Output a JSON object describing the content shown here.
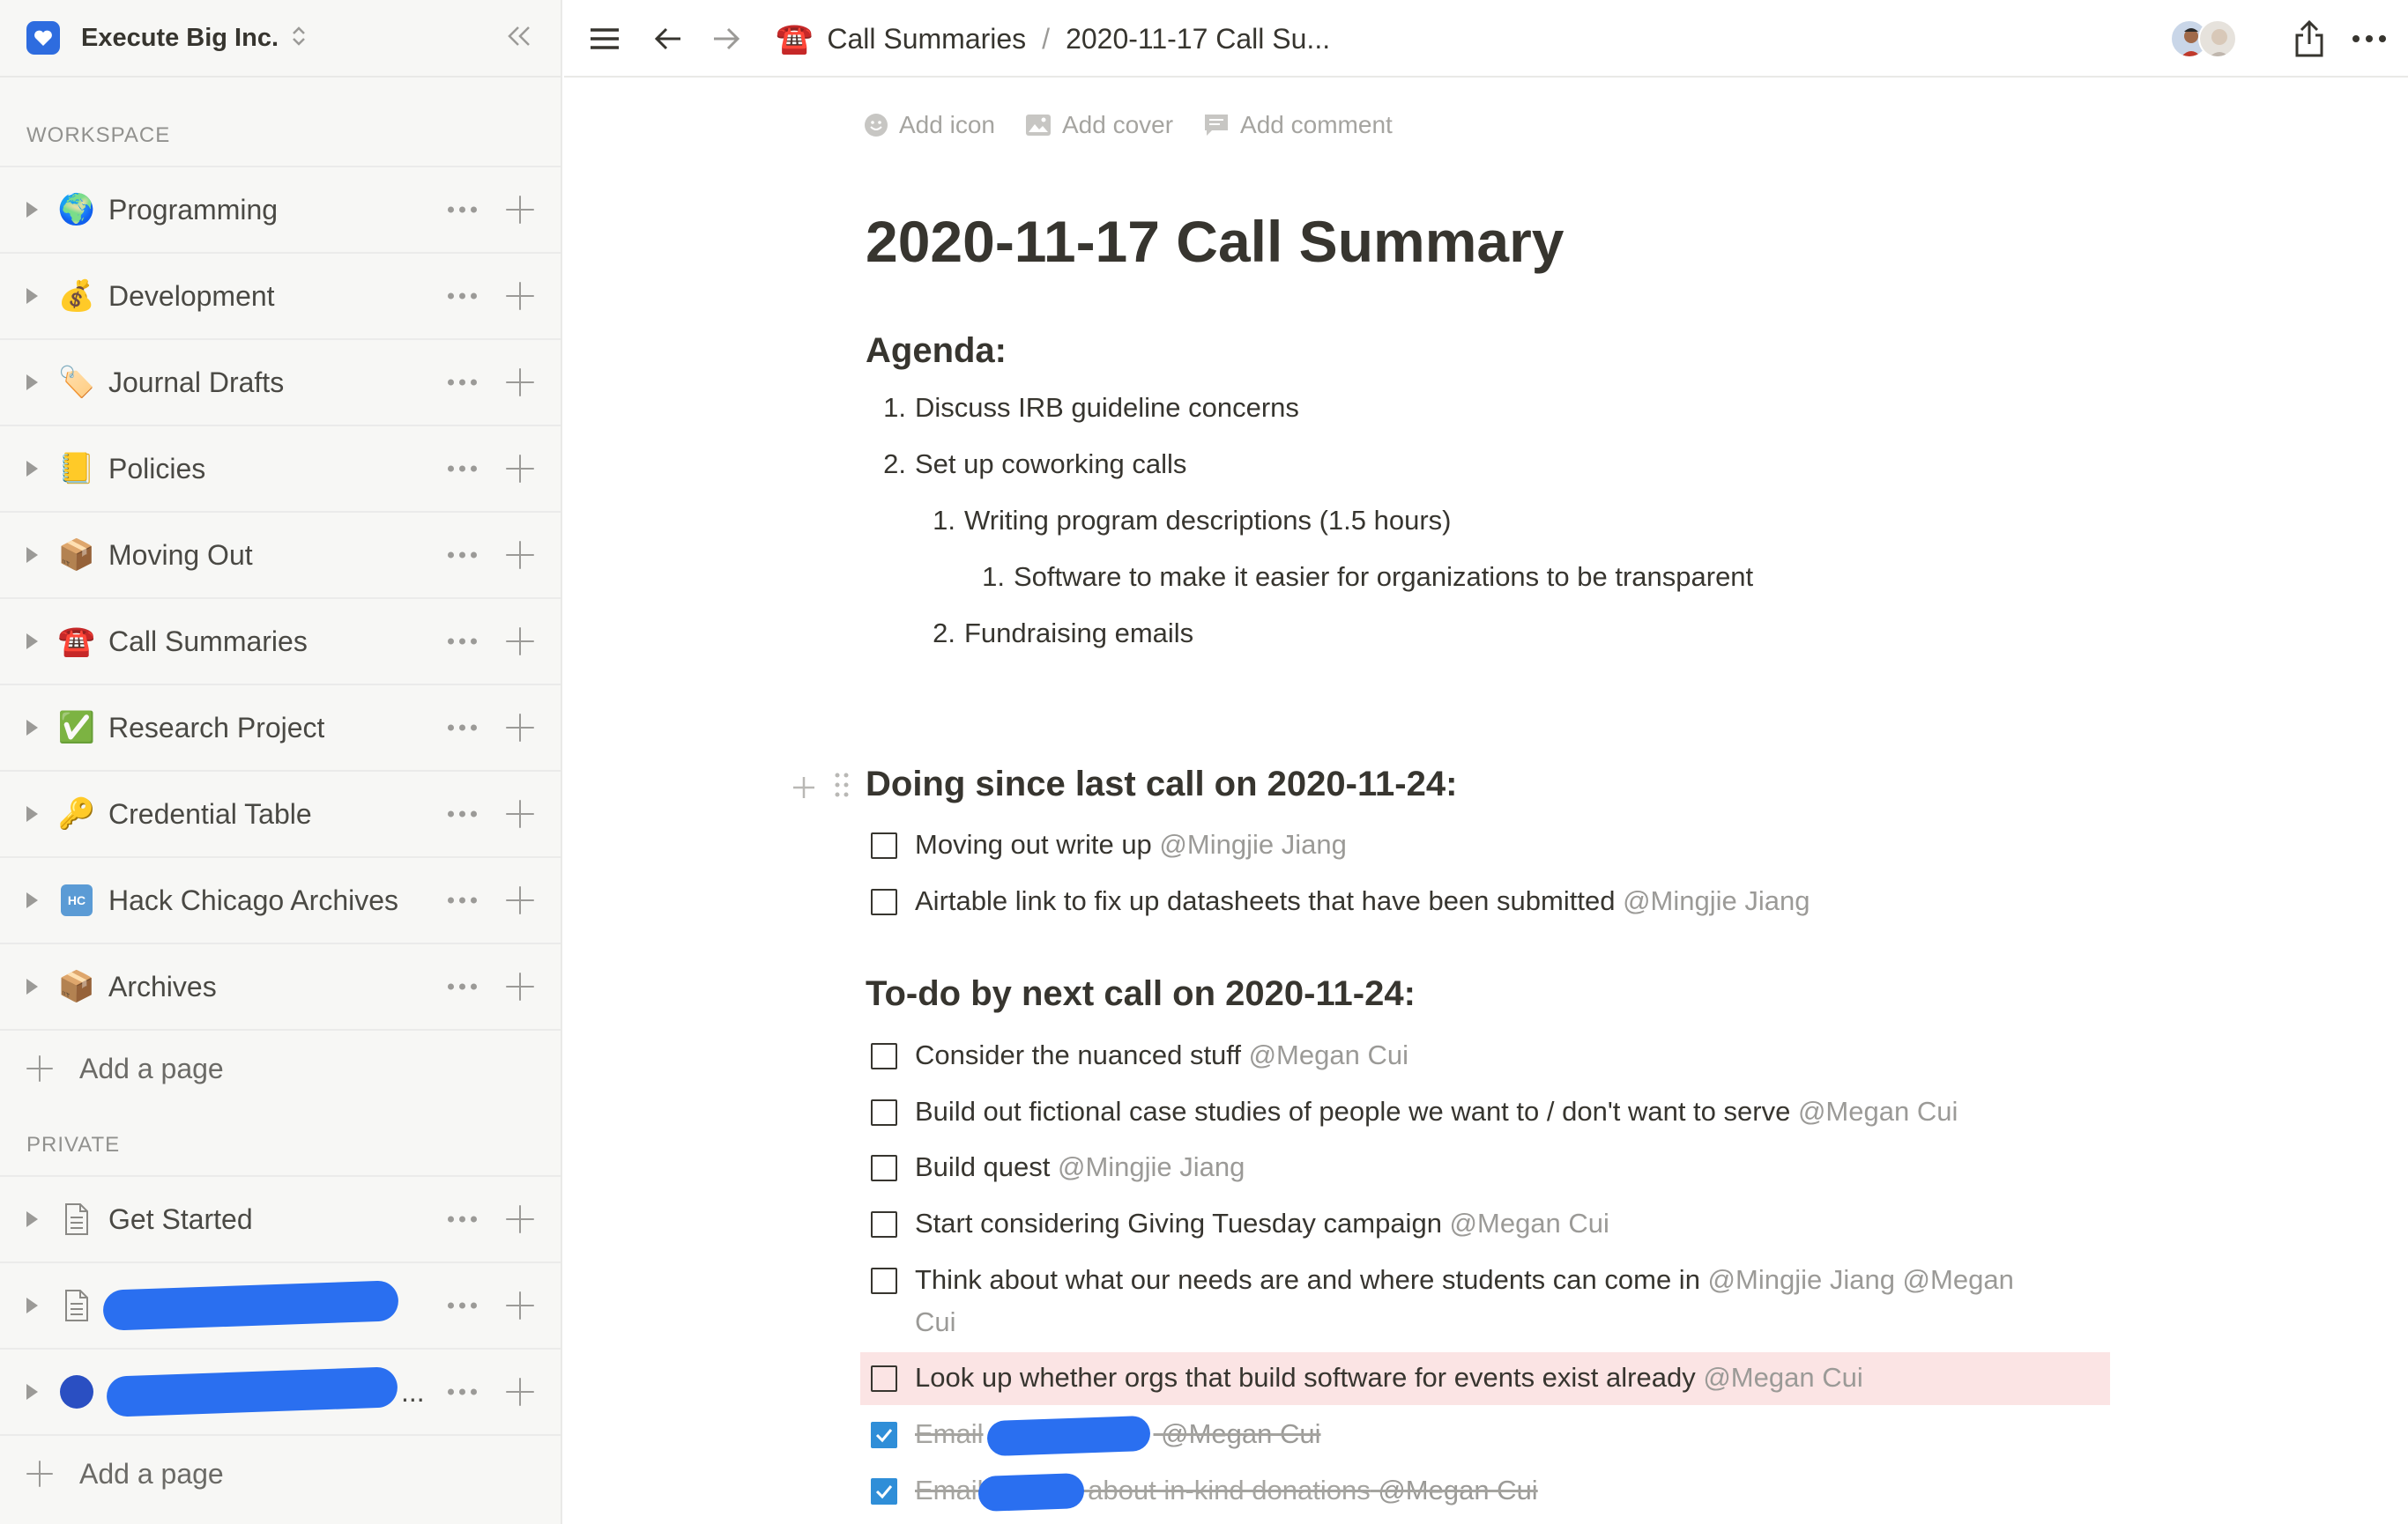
{
  "workspace": {
    "name": "Execute Big Inc."
  },
  "sidebar": {
    "workspace_label": "WORKSPACE",
    "private_label": "PRIVATE",
    "add_page_label": "Add a page",
    "workspace_items": [
      {
        "label": "Programming",
        "emoji": "🌍"
      },
      {
        "label": "Development",
        "emoji": "💰"
      },
      {
        "label": "Journal Drafts",
        "emoji": "🏷️"
      },
      {
        "label": "Policies",
        "emoji": "📒"
      },
      {
        "label": "Moving Out",
        "emoji": "📦"
      },
      {
        "label": "Call Summaries",
        "emoji": "☎️"
      },
      {
        "label": "Research Project",
        "emoji": "✅"
      },
      {
        "label": "Credential Table",
        "emoji": "🔑"
      },
      {
        "label": "Hack Chicago Archives",
        "emoji": "HC"
      },
      {
        "label": "Archives",
        "emoji": "📦"
      }
    ],
    "private_items": [
      {
        "label": "Get Started"
      },
      {
        "label": "",
        "redacted": true
      },
      {
        "label": "...",
        "redacted": true
      }
    ]
  },
  "topbar": {
    "breadcrumb_parent": "Call Summaries",
    "breadcrumb_separator": "/",
    "breadcrumb_current": "2020-11-17 Call Su..."
  },
  "page": {
    "actions": {
      "add_icon": "Add icon",
      "add_cover": "Add cover",
      "add_comment": "Add comment"
    },
    "title": "2020-11-17 Call Summary",
    "agenda_heading": "Agenda:",
    "agenda": [
      {
        "num": "1.",
        "text": "Discuss IRB guideline concerns"
      },
      {
        "num": "2.",
        "text": "Set up coworking calls"
      },
      {
        "num": "1.",
        "text": "Writing program descriptions (1.5 hours)"
      },
      {
        "num": "1.",
        "text": "Software to make it easier for organizations to be transparent"
      },
      {
        "num": "2.",
        "text": "Fundraising emails"
      }
    ],
    "doing_heading": "Doing since last call on 2020-11-24:",
    "doing": [
      {
        "text": "Moving out write up ",
        "mention": "@Mingjie Jiang"
      },
      {
        "text": "Airtable link to fix up datasheets that have been submitted ",
        "mention": "@Mingjie Jiang"
      }
    ],
    "todo_heading": "To-do by next call on 2020-11-24:",
    "todos": [
      {
        "text": "Consider the nuanced stuff ",
        "mention": "@Megan Cui"
      },
      {
        "text": "Build out fictional case studies of people we want to / don't want to serve ",
        "mention": "@Megan Cui"
      },
      {
        "text": "Build quest ",
        "mention": "@Mingjie Jiang"
      },
      {
        "text": "Start considering Giving Tuesday campaign ",
        "mention": "@Megan Cui"
      },
      {
        "text": "Think about what our needs are and where students can come in ",
        "mention": "@Mingjie Jiang @Megan",
        "wrap": "Cui"
      },
      {
        "text": "Look up whether orgs that build software for events exist already ",
        "mention": "@Megan Cui"
      },
      {
        "text": "Email",
        "mention": " @Megan Cui",
        "done": true
      },
      {
        "text": "Email",
        "middle": " about in-kind donations",
        "mention": " @Megan Cui",
        "done": true
      }
    ]
  },
  "colors": {
    "accent": "#2e6cdf",
    "highlight": "#fbe4e4",
    "checked": "#2f8ed8",
    "redaction": "#2a6ff0"
  }
}
